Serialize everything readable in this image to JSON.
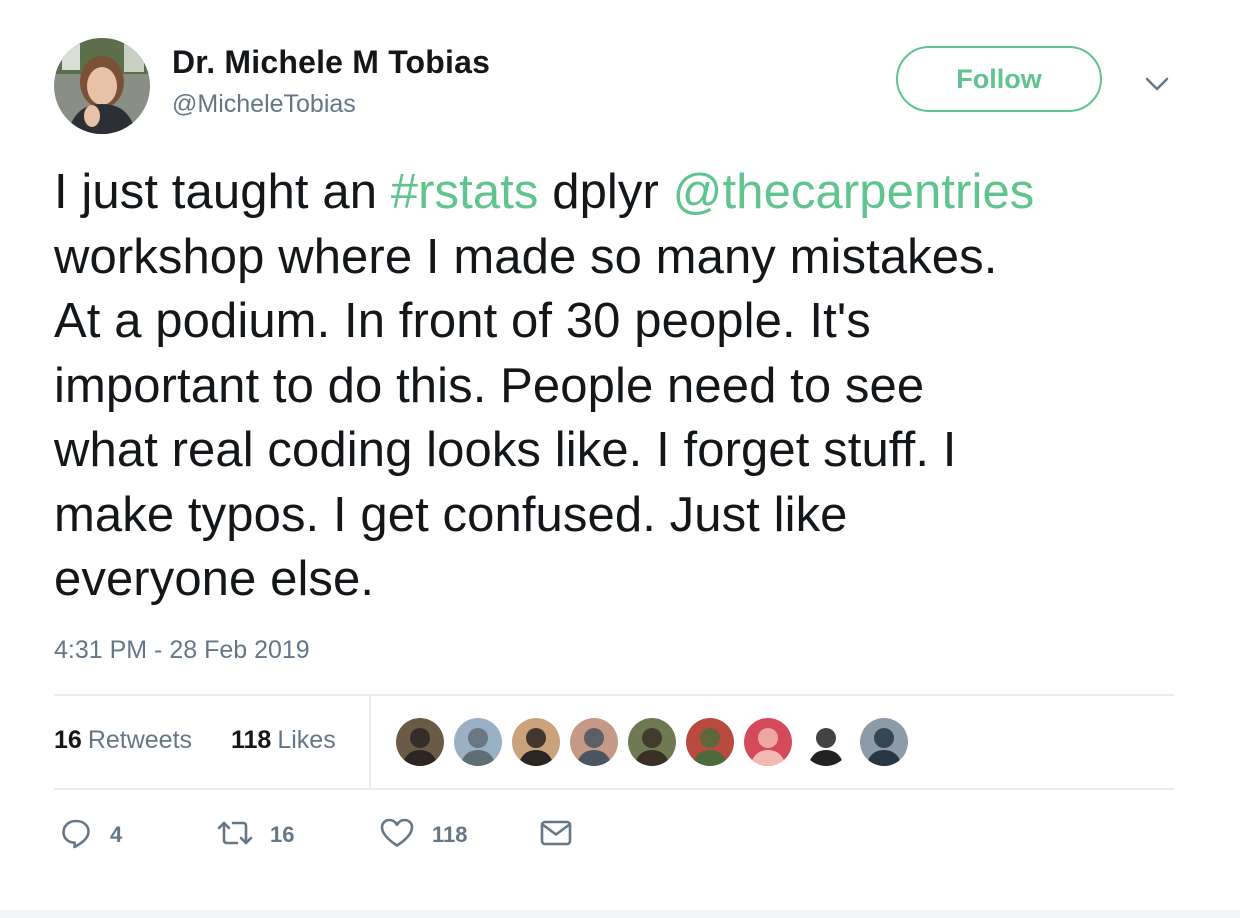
{
  "author": {
    "display_name": "Dr. Michele M Tobias",
    "handle": "@MicheleTobias",
    "avatar_icon": "profile-photo"
  },
  "follow_button": {
    "label": "Follow",
    "color": "#5fc48e"
  },
  "menu": {
    "icon": "chevron-down-icon"
  },
  "tweet": {
    "lines": [
      [
        {
          "t": "I just taught an "
        },
        {
          "t": "#rstats",
          "link": true
        },
        {
          "t": " dplyr "
        },
        {
          "t": "@thecarpentries",
          "link": true
        }
      ],
      [
        {
          "t": "workshop where I made so many mistakes."
        }
      ],
      [
        {
          "t": "At a podium. In front of 30 people. It's"
        }
      ],
      [
        {
          "t": "important to do this. People need to see"
        }
      ],
      [
        {
          "t": "what real coding looks like. I forget stuff. I"
        }
      ],
      [
        {
          "t": "make typos. I get confused. Just like"
        }
      ],
      [
        {
          "t": "everyone else."
        }
      ]
    ],
    "timestamp": "4:31 PM - 28 Feb 2019"
  },
  "stats": {
    "retweets_count": "16",
    "retweets_label": "Retweets",
    "likes_count": "118",
    "likes_label": "Likes"
  },
  "likers": [
    {
      "name": "liker-avatar-1",
      "colors": [
        "#6b5a45",
        "#2c2623"
      ]
    },
    {
      "name": "liker-avatar-2",
      "colors": [
        "#9ab0c4",
        "#5f6d74"
      ]
    },
    {
      "name": "liker-avatar-3",
      "colors": [
        "#caa27b",
        "#2a2622"
      ]
    },
    {
      "name": "liker-avatar-4",
      "colors": [
        "#c49a84",
        "#4a5560"
      ]
    },
    {
      "name": "liker-avatar-5",
      "colors": [
        "#6f7a52",
        "#3b3026"
      ]
    },
    {
      "name": "liker-avatar-6",
      "colors": [
        "#b94a3f",
        "#4d6b3a"
      ]
    },
    {
      "name": "liker-avatar-7",
      "colors": [
        "#d44a5a",
        "#f2b8b2"
      ]
    },
    {
      "name": "liker-avatar-8",
      "colors": [
        "#ffffff",
        "#222222"
      ]
    },
    {
      "name": "liker-avatar-9",
      "colors": [
        "#8d9aa7",
        "#283645"
      ]
    }
  ],
  "actions": {
    "reply_count": "4",
    "retweet_count": "16",
    "like_count": "118"
  },
  "colors": {
    "accent": "#5fc48e",
    "muted": "#657786",
    "text": "#14171a"
  }
}
